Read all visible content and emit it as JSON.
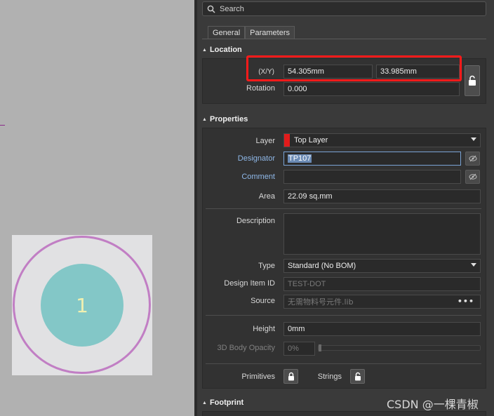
{
  "canvas": {
    "pad_number": "1"
  },
  "search": {
    "placeholder": "Search"
  },
  "tabs": [
    {
      "label": "General"
    },
    {
      "label": "Parameters"
    }
  ],
  "location": {
    "title": "Location",
    "xy_label": "(X/Y)",
    "x_value": "54.305mm",
    "y_value": "33.985mm",
    "rotation_label": "Rotation",
    "rotation_value": "0.000"
  },
  "properties": {
    "title": "Properties",
    "layer_label": "Layer",
    "layer_value": "Top Layer",
    "layer_color": "#e21b1b",
    "designator_label": "Designator",
    "designator_value": "TP107",
    "comment_label": "Comment",
    "comment_value": "",
    "area_label": "Area",
    "area_value": "22.09 sq.mm",
    "description_label": "Description",
    "description_value": "",
    "type_label": "Type",
    "type_value": "Standard (No BOM)",
    "design_item_id_label": "Design Item ID",
    "design_item_id_value": "TEST-DOT",
    "source_label": "Source",
    "source_value": "无需物料号元件.lib",
    "height_label": "Height",
    "height_value": "0mm",
    "body_opacity_label": "3D Body Opacity",
    "body_opacity_value": "0%",
    "primitives_label": "Primitives",
    "strings_label": "Strings"
  },
  "footprint": {
    "title": "Footprint"
  },
  "watermark": "CSDN @一棵青椒",
  "colors": {
    "highlight": "#ff1a1a",
    "link": "#8fb8e8",
    "panel_bg": "#3a3a3a"
  }
}
